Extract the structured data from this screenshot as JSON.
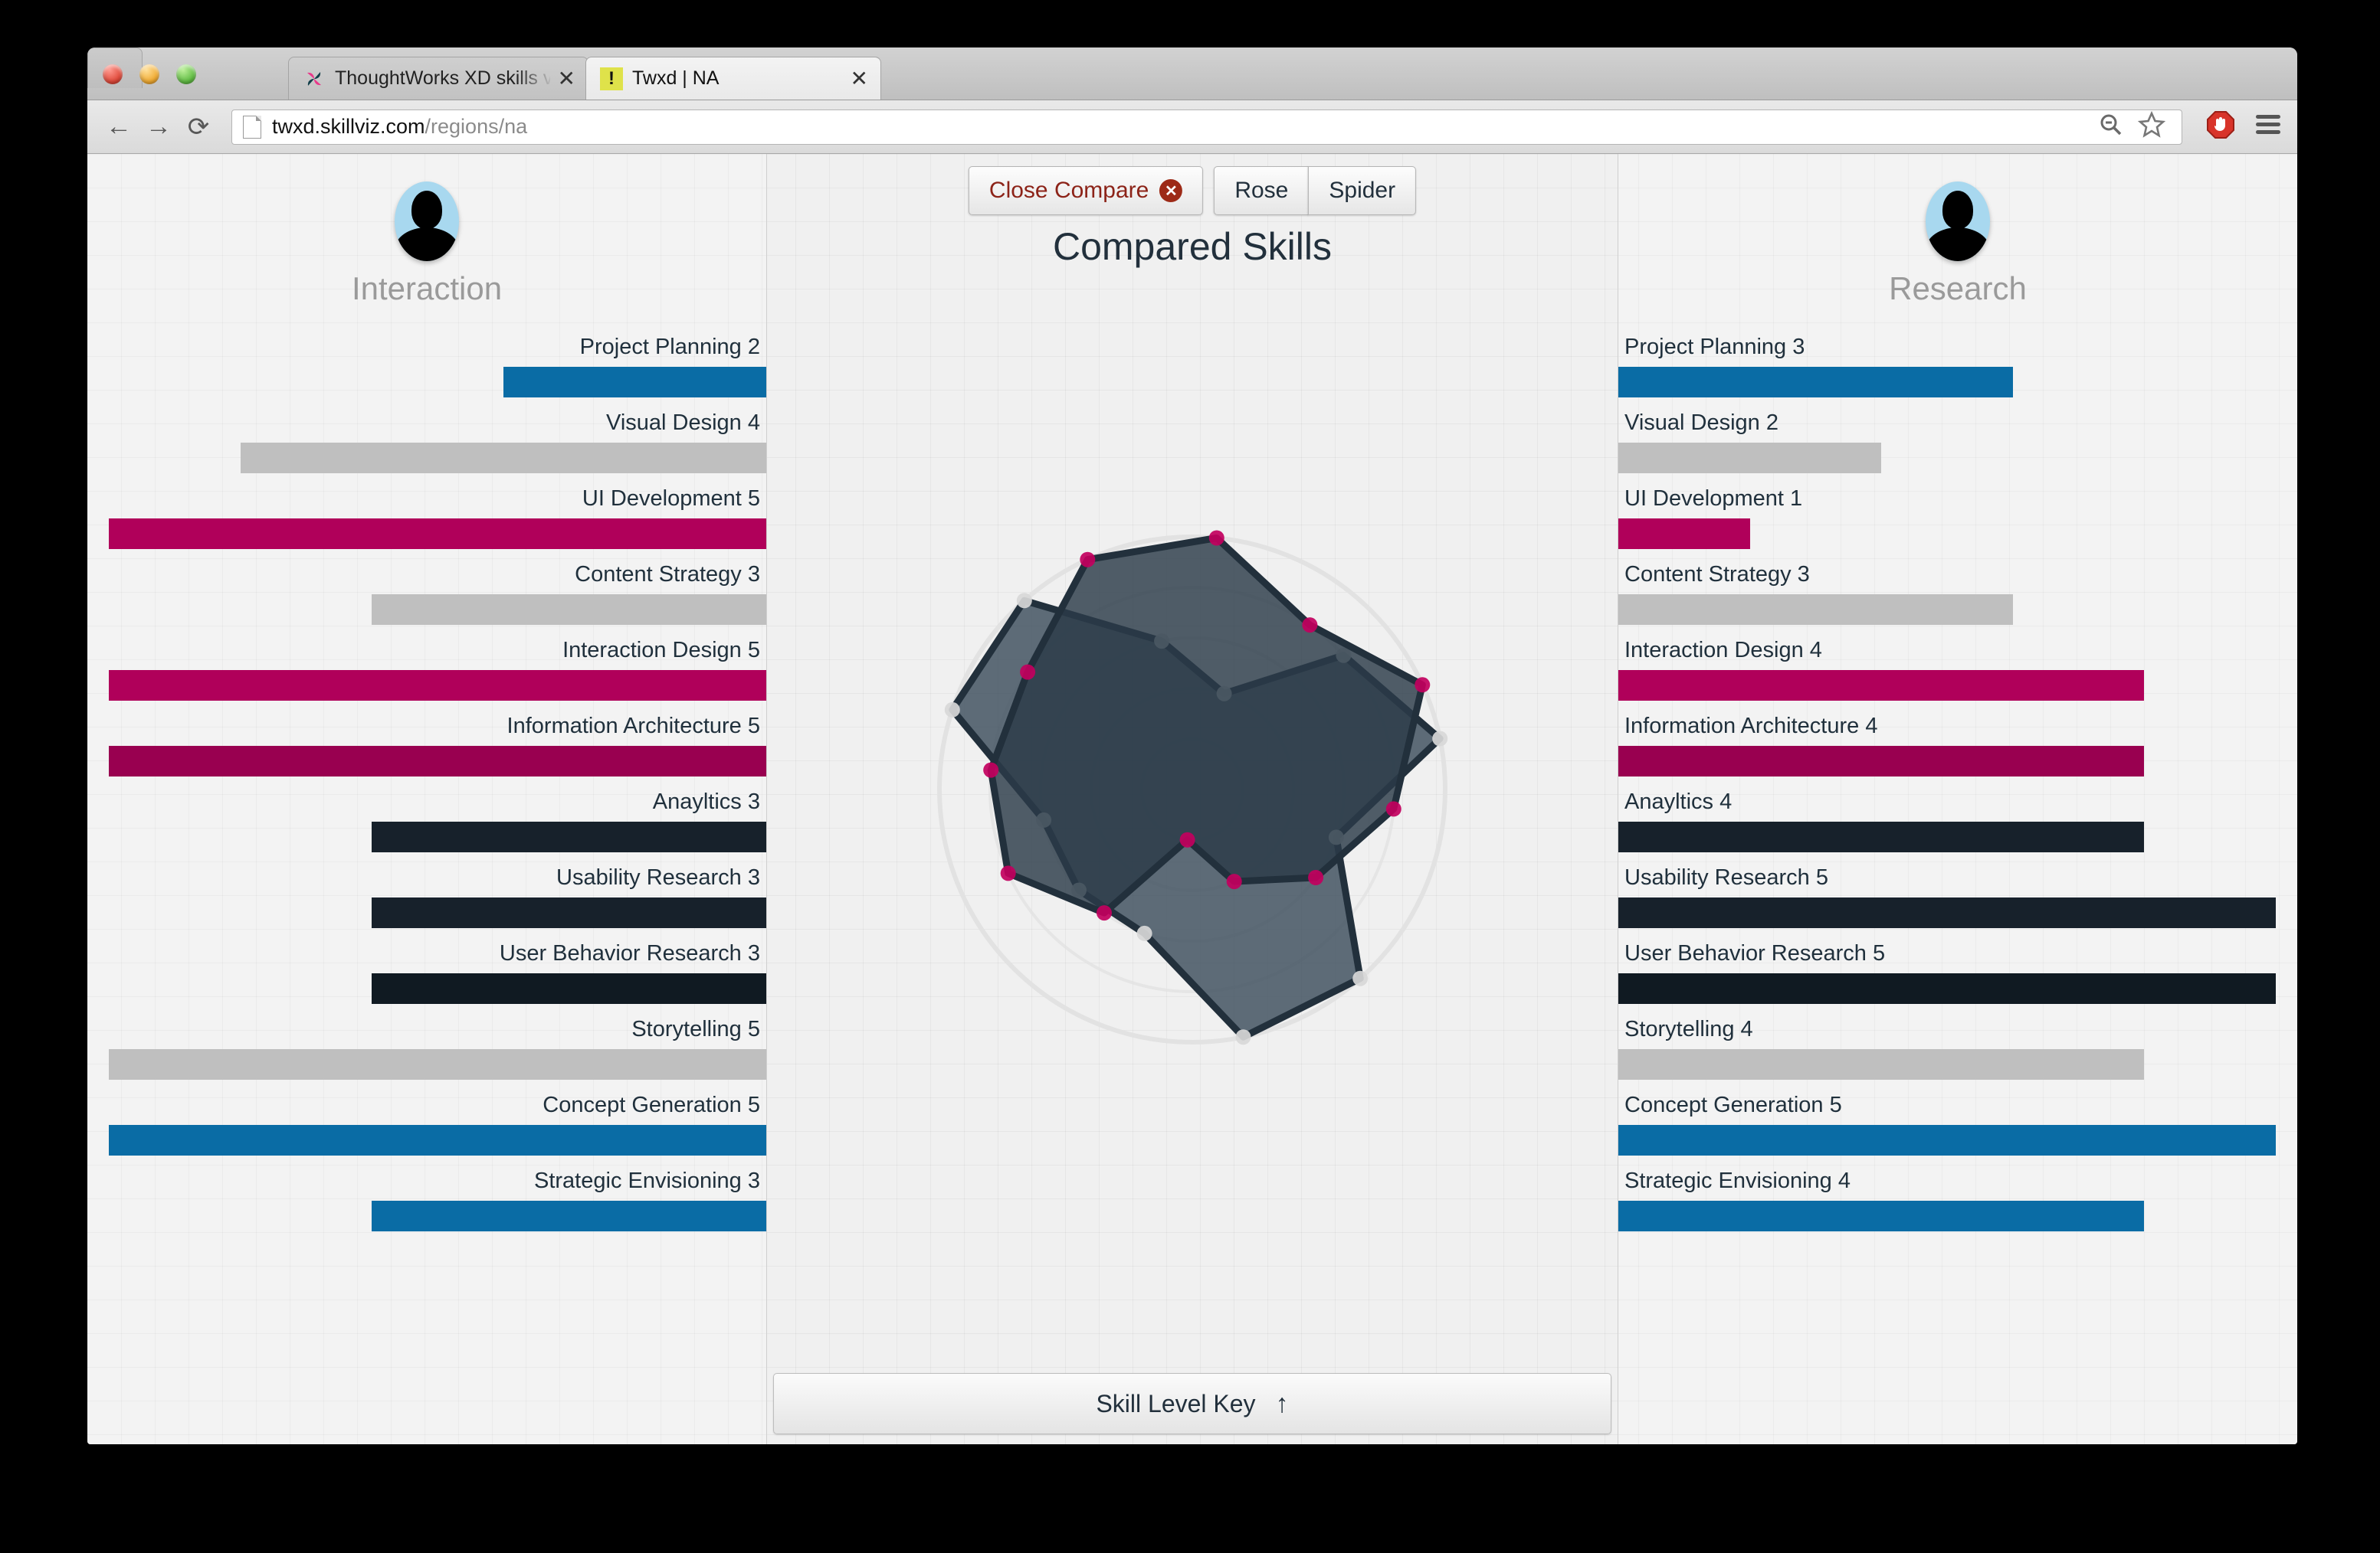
{
  "browser": {
    "tabs": [
      {
        "title": "ThoughtWorks XD skills vis",
        "icon": "thoughtworks-logo",
        "active": false,
        "close_label": "✕"
      },
      {
        "title": "Twxd | NA",
        "icon": "warning-icon",
        "active": true,
        "close_label": "✕"
      }
    ],
    "nav": {
      "back": "←",
      "forward": "→",
      "reload": "⟳"
    },
    "url_main": "twxd.skillviz.com",
    "url_path": "/regions/na",
    "icons": {
      "zoom_out": "zoom-out-icon",
      "bookmark": "star-icon",
      "adblock": "adblock-icon",
      "menu": "hamburger-menu-icon"
    }
  },
  "toolbar": {
    "close_compare": "Close Compare",
    "rose": "Rose",
    "spider": "Spider"
  },
  "center": {
    "title": "Compared Skills",
    "key_label": "Skill Level Key",
    "key_arrow": "↑"
  },
  "left_panel": {
    "name": "Interaction",
    "avatar": "user-avatar-icon",
    "skills": [
      {
        "label": "Project Planning 2",
        "value": 2,
        "color": "#0a6ca5"
      },
      {
        "label": "Visual Design 4",
        "value": 4,
        "color": "#bfbfbf"
      },
      {
        "label": "UI Development 5",
        "value": 5,
        "color": "#b0005a"
      },
      {
        "label": "Content Strategy 3",
        "value": 3,
        "color": "#bfbfbf"
      },
      {
        "label": "Interaction Design 5",
        "value": 5,
        "color": "#b0005a"
      },
      {
        "label": "Information Architecture 5",
        "value": 5,
        "color": "#990050"
      },
      {
        "label": "Anayltics 3",
        "value": 3,
        "color": "#17212b"
      },
      {
        "label": "Usability Research 3",
        "value": 3,
        "color": "#17212b"
      },
      {
        "label": "User Behavior Research 3",
        "value": 3,
        "color": "#101a22"
      },
      {
        "label": "Storytelling 5",
        "value": 5,
        "color": "#bfbfbf"
      },
      {
        "label": "Concept Generation 5",
        "value": 5,
        "color": "#0a6ca5"
      },
      {
        "label": "Strategic Envisioning 3",
        "value": 3,
        "color": "#0a6ca5"
      }
    ]
  },
  "right_panel": {
    "name": "Research",
    "avatar": "user-avatar-icon",
    "skills": [
      {
        "label": "Project Planning 3",
        "value": 3,
        "color": "#0a6ca5"
      },
      {
        "label": "Visual Design 2",
        "value": 2,
        "color": "#bfbfbf"
      },
      {
        "label": "UI Development 1",
        "value": 1,
        "color": "#b0005a"
      },
      {
        "label": "Content Strategy 3",
        "value": 3,
        "color": "#bfbfbf"
      },
      {
        "label": "Interaction Design 4",
        "value": 4,
        "color": "#b0005a"
      },
      {
        "label": "Information Architecture 4",
        "value": 4,
        "color": "#990050"
      },
      {
        "label": "Anayltics 4",
        "value": 4,
        "color": "#17212b"
      },
      {
        "label": "Usability Research 5",
        "value": 5,
        "color": "#17212b"
      },
      {
        "label": "User Behavior Research 5",
        "value": 5,
        "color": "#101a22"
      },
      {
        "label": "Storytelling 4",
        "value": 4,
        "color": "#bfbfbf"
      },
      {
        "label": "Concept Generation 5",
        "value": 5,
        "color": "#0a6ca5"
      },
      {
        "label": "Strategic Envisioning 4",
        "value": 4,
        "color": "#0a6ca5"
      }
    ]
  },
  "chart_data": {
    "type": "radar",
    "title": "Compared Skills",
    "axes": [
      "Project Planning",
      "Visual Design",
      "UI Development",
      "Content Strategy",
      "Interaction Design",
      "Information Architecture",
      "Anayltics",
      "Usability Research",
      "User Behavior Research",
      "Storytelling",
      "Concept Generation",
      "Strategic Envisioning"
    ],
    "rmax": 5,
    "rings": [
      1,
      2,
      3,
      4,
      5
    ],
    "grid": true,
    "legend": "none",
    "series": [
      {
        "name": "Interaction",
        "point_color": "#d8d8d8",
        "fill": "#3c4d5c",
        "stroke": "#22303c",
        "values": [
          2,
          4,
          5,
          3,
          5,
          5,
          3,
          3,
          3,
          5,
          5,
          3
        ]
      },
      {
        "name": "Research",
        "point_color": "#c2005e",
        "fill": "#2b3b48",
        "stroke": "#22303c",
        "values": [
          3,
          2,
          1,
          3,
          4,
          4,
          4,
          5,
          5,
          4,
          5,
          4
        ]
      }
    ]
  }
}
